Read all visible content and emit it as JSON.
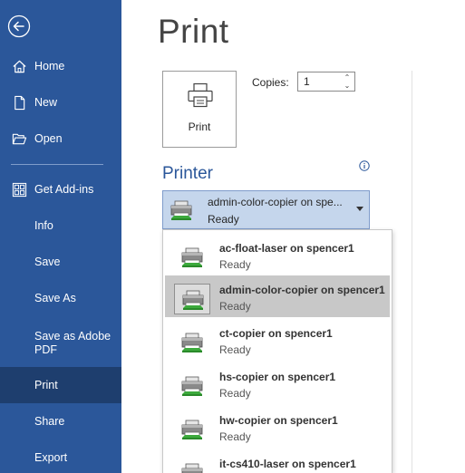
{
  "sidebar": {
    "items": [
      {
        "label": "Home",
        "icon": "home-icon"
      },
      {
        "label": "New",
        "icon": "new-document-icon"
      },
      {
        "label": "Open",
        "icon": "folder-open-icon"
      },
      {
        "label": "Get Add-ins",
        "icon": "grid-addins-icon"
      },
      {
        "label": "Info"
      },
      {
        "label": "Save"
      },
      {
        "label": "Save As"
      },
      {
        "label": "Save as Adobe PDF"
      },
      {
        "label": "Print",
        "active": true
      },
      {
        "label": "Share"
      },
      {
        "label": "Export"
      }
    ]
  },
  "main": {
    "title": "Print",
    "print_button_label": "Print",
    "copies_label": "Copies:",
    "copies_value": "1",
    "printer_heading": "Printer",
    "selected_printer": {
      "name": "admin-color-copier on spe...",
      "status": "Ready"
    },
    "printers": [
      {
        "name": "ac-float-laser on spencer1",
        "status": "Ready"
      },
      {
        "name": "admin-color-copier on spencer1",
        "status": "Ready",
        "selected": true
      },
      {
        "name": "ct-copier on spencer1",
        "status": "Ready"
      },
      {
        "name": "hs-copier on spencer1",
        "status": "Ready"
      },
      {
        "name": "hw-copier on spencer1",
        "status": "Ready"
      },
      {
        "name": "it-cs410-laser on spencer1",
        "status": ""
      }
    ]
  },
  "colors": {
    "sidebar": "#2b579a",
    "active_nav": "#1e3e6e",
    "accent": "#2b579a",
    "selection": "#c8c8c8",
    "printer_select": "#c5d6ec"
  }
}
